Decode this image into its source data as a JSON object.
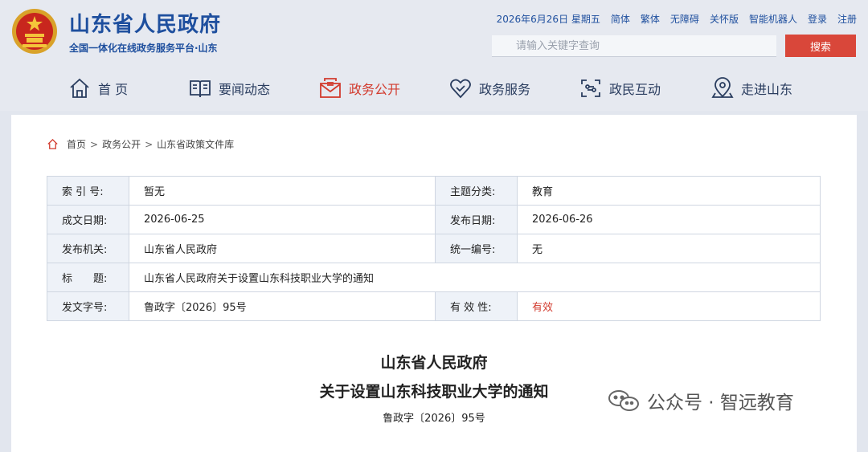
{
  "header": {
    "site_title": "山东省人民政府",
    "site_subtitle": "全国一体化在线政务服务平台·山东",
    "toplinks": [
      "2026年6月26日 星期五",
      "简体",
      "繁体",
      "无障碍",
      "关怀版",
      "智能机器人",
      "登录",
      "注册"
    ],
    "search_placeholder": "请输入关键字查询",
    "search_button": "搜索"
  },
  "nav": [
    {
      "label": "首 页",
      "icon": "home-icon",
      "active": false
    },
    {
      "label": "要闻动态",
      "icon": "book-icon",
      "active": false
    },
    {
      "label": "政务公开",
      "icon": "mail-icon",
      "active": true
    },
    {
      "label": "政务服务",
      "icon": "heart-icon",
      "active": false
    },
    {
      "label": "政民互动",
      "icon": "interact-icon",
      "active": false
    },
    {
      "label": "走进山东",
      "icon": "location-icon",
      "active": false
    }
  ],
  "breadcrumb": [
    "首页",
    "政务公开",
    "山东省政策文件库"
  ],
  "meta": {
    "index_label": "索 引 号:",
    "index_value": "暂无",
    "topic_label": "主题分类:",
    "topic_value": "教育",
    "date_label": "成文日期:",
    "date_value": "2026-06-25",
    "pubdate_label": "发布日期:",
    "pubdate_value": "2026-06-26",
    "org_label": "发布机关:",
    "org_value": "山东省人民政府",
    "code_label": "统一编号:",
    "code_value": "无",
    "title_label": "标　　题:",
    "title_value": "山东省人民政府关于设置山东科技职业大学的通知",
    "docno_label": "发文字号:",
    "docno_value": "鲁政字〔2026〕95号",
    "validity_label": "有 效 性:",
    "validity_value": "有效"
  },
  "document": {
    "title_line1": "山东省人民政府",
    "title_line2": "关于设置山东科技职业大学的通知",
    "doc_number": "鲁政字〔2026〕95号"
  },
  "watermark": "公众号 · 智远教育",
  "colors": {
    "brand_blue": "#1e4f9e",
    "accent_red": "#d23b2e"
  }
}
